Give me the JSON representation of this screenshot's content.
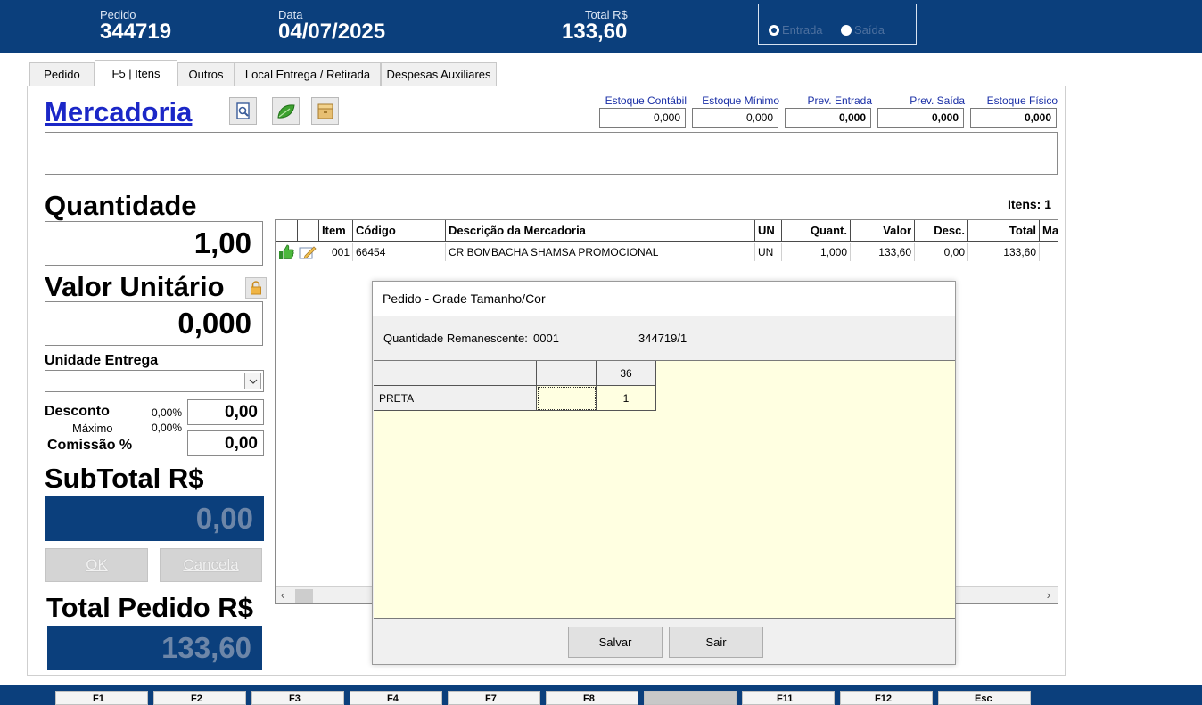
{
  "header": {
    "pedido_label": "Pedido",
    "pedido_value": "344719",
    "data_label": "Data",
    "data_value": "04/07/2025",
    "total_label": "Total R$",
    "total_value": "133,60",
    "radio_entrada": "Entrada",
    "radio_saida": "Saída",
    "colors": {
      "header_bg": "#0b3f7c"
    }
  },
  "tabs": [
    "Pedido",
    "F5 | Itens",
    "Outros",
    "Local Entrega  / Retirada",
    "Despesas Auxiliares"
  ],
  "mercadoria": {
    "title": "Mercadoria",
    "toolbar_icons": [
      "search-document-icon",
      "leaf-icon",
      "box-icon"
    ],
    "stock": [
      {
        "label": "Estoque Contábil",
        "value": "0,000"
      },
      {
        "label": "Estoque Mínimo",
        "value": "0,000"
      },
      {
        "label": "Prev. Entrada",
        "value": "0,000"
      },
      {
        "label": "Prev. Saída",
        "value": "0,000"
      },
      {
        "label": "Estoque Físico",
        "value": "0,000"
      }
    ]
  },
  "form": {
    "quantidade_label": "Quantidade",
    "quantidade_value": "1,00",
    "valor_unitario_label": "Valor Unitário",
    "valor_unitario_value": "0,000",
    "unidade_entrega_label": "Unidade Entrega",
    "desconto_label": "Desconto",
    "desconto_pct": "0,00%",
    "desconto_value": "0,00",
    "maximo_label": "Máximo",
    "maximo_pct": "0,00%",
    "comissao_label": "Comissão %",
    "comissao_value": "0,00",
    "subtotal_label": "SubTotal R$",
    "subtotal_value": "0,00",
    "ok_label": "OK",
    "cancela_label": "Cancela",
    "total_pedido_label": "Total Pedido R$",
    "total_pedido_value": "133,60"
  },
  "items": {
    "count_label": "Itens: 1",
    "headers": [
      "Item",
      "Código",
      "Descrição da Mercadoria",
      "UN",
      "Quant.",
      "Valor",
      "Desc.",
      "Total",
      "Ma"
    ],
    "rows": [
      {
        "item": "001",
        "codigo": "66454",
        "descricao": "CR BOMBACHA SHAMSA PROMOCIONAL",
        "un": "UN",
        "quant": "1,000",
        "valor": "133,60",
        "desc": "0,00",
        "total": "133,60"
      }
    ]
  },
  "dialog": {
    "title": "Pedido - Grade Tamanho/Cor",
    "remanescente_label": "Quantidade Remanescente:",
    "remanescente_value": "0001",
    "ref": "344719/1",
    "grid_header_size": "36",
    "grid_row_color": "PRETA",
    "grid_row_qty": "1",
    "salvar": "Salvar",
    "sair": "Sair"
  },
  "fkeys": [
    "F1",
    "F2",
    "F3",
    "F4",
    "F7",
    "F8",
    "",
    "F11",
    "F12",
    "Esc"
  ]
}
